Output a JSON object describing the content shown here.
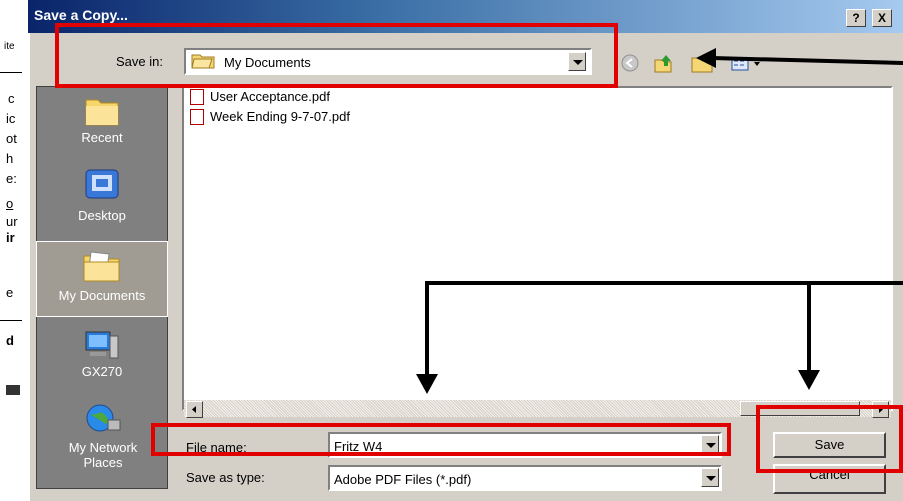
{
  "background_window": {
    "letters": [
      "ite",
      "c",
      "ic",
      "ot",
      "h",
      "e:",
      "o",
      "ur",
      "ir",
      "e",
      "d"
    ]
  },
  "dialog": {
    "title": "Save a Copy...",
    "help_button": "?",
    "close_button": "X",
    "save_in_label": "Save in:",
    "save_in_value": "My Documents",
    "places": [
      {
        "label": "Recent"
      },
      {
        "label": "Desktop"
      },
      {
        "label": "My Documents"
      },
      {
        "label": "GX270"
      },
      {
        "label": "My Network Places"
      }
    ],
    "files": [
      {
        "name": "User Acceptance.pdf"
      },
      {
        "name": "Week Ending 9-7-07.pdf"
      }
    ],
    "file_name_label": "File name:",
    "file_name_value": "Fritz W4",
    "save_as_type_label": "Save as type:",
    "save_as_type_value": "Adobe PDF Files (*.pdf)",
    "save_button": "Save",
    "cancel_button": "Cancel"
  },
  "colors": {
    "annotation_red": "#e00000",
    "title_bar": "#0a246a",
    "dialog_face": "#d4d0c8"
  }
}
